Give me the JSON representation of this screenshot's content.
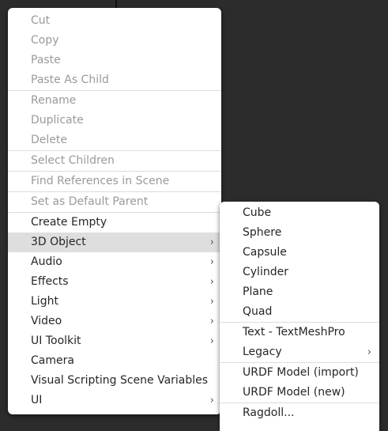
{
  "main_menu": {
    "groups": [
      [
        {
          "label": "Cut",
          "enabled": false
        },
        {
          "label": "Copy",
          "enabled": false
        },
        {
          "label": "Paste",
          "enabled": false
        },
        {
          "label": "Paste As Child",
          "enabled": false
        }
      ],
      [
        {
          "label": "Rename",
          "enabled": false
        },
        {
          "label": "Duplicate",
          "enabled": false
        },
        {
          "label": "Delete",
          "enabled": false
        }
      ],
      [
        {
          "label": "Select Children",
          "enabled": false
        }
      ],
      [
        {
          "label": "Find References in Scene",
          "enabled": false
        }
      ],
      [
        {
          "label": "Set as Default Parent",
          "enabled": false
        }
      ],
      [
        {
          "label": "Create Empty",
          "enabled": true,
          "submenu": false
        },
        {
          "label": "3D Object",
          "enabled": true,
          "submenu": true,
          "highlighted": true
        },
        {
          "label": "Audio",
          "enabled": true,
          "submenu": true
        },
        {
          "label": "Effects",
          "enabled": true,
          "submenu": true
        },
        {
          "label": "Light",
          "enabled": true,
          "submenu": true
        },
        {
          "label": "Video",
          "enabled": true,
          "submenu": true
        },
        {
          "label": "UI Toolkit",
          "enabled": true,
          "submenu": true
        },
        {
          "label": "Camera",
          "enabled": true,
          "submenu": false
        },
        {
          "label": "Visual Scripting Scene Variables",
          "enabled": true,
          "submenu": false
        },
        {
          "label": "UI",
          "enabled": true,
          "submenu": true
        }
      ]
    ]
  },
  "sub_menu": {
    "groups": [
      [
        {
          "label": "Cube",
          "enabled": true
        },
        {
          "label": "Sphere",
          "enabled": true
        },
        {
          "label": "Capsule",
          "enabled": true
        },
        {
          "label": "Cylinder",
          "enabled": true
        },
        {
          "label": "Plane",
          "enabled": true
        },
        {
          "label": "Quad",
          "enabled": true
        }
      ],
      [
        {
          "label": "Text - TextMeshPro",
          "enabled": true
        },
        {
          "label": "Legacy",
          "enabled": true,
          "submenu": true
        }
      ],
      [
        {
          "label": "URDF Model (import)",
          "enabled": true
        },
        {
          "label": "URDF Model (new)",
          "enabled": true
        }
      ],
      [
        {
          "label": "Ragdoll...",
          "enabled": true
        }
      ]
    ]
  },
  "icons": {
    "submenu_arrow": "chevron-right-icon",
    "arrow_glyph": "›"
  }
}
